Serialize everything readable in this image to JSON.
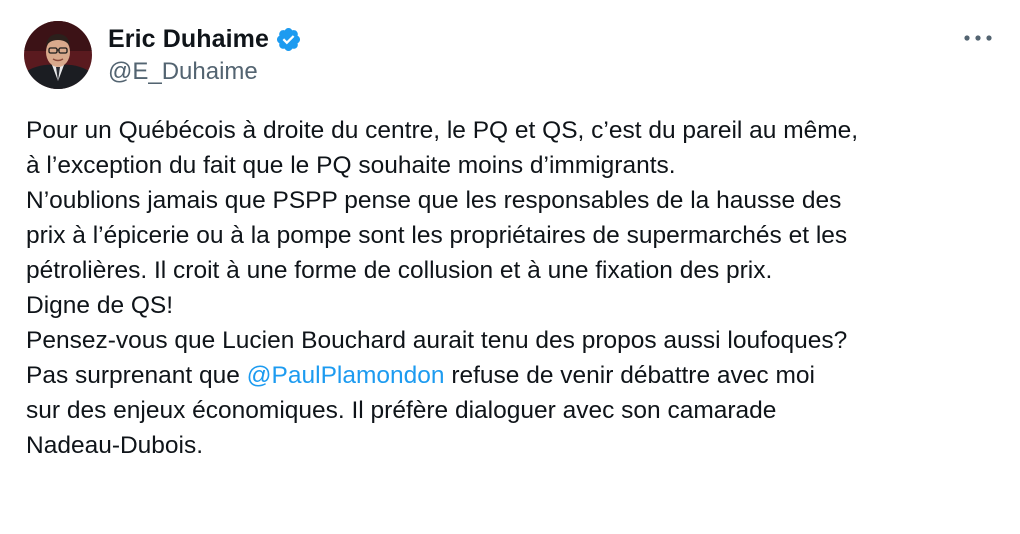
{
  "author": {
    "display_name": "Eric Duhaime",
    "handle": "@E_Duhaime",
    "verified": true,
    "verified_color": "#1d9bf0",
    "avatar_icon": "avatar-photo"
  },
  "menu": {
    "icon": "more-icon"
  },
  "tweet": {
    "lines": [
      "Pour un Québécois à droite du centre, le PQ et QS, c’est du pareil au même,",
      "à l’exception du fait que le PQ souhaite moins d’immigrants.",
      "N’oublions jamais que PSPP pense que les responsables de la hausse des",
      "prix à l’épicerie ou à la pompe sont les propriétaires de supermarchés et les",
      "pétrolières. Il croit à une forme de collusion et à une fixation des prix.",
      "Digne de QS!",
      "Pensez-vous que Lucien Bouchard aurait tenu des propos aussi loufoques?"
    ],
    "mention_line": {
      "prefix": "Pas surprenant que ",
      "mention": "@PaulPlamondon",
      "suffix": " refuse de venir débattre avec moi"
    },
    "tail_lines": [
      "sur des enjeux économiques. Il préfère dialoguer avec son camarade",
      "Nadeau-Dubois."
    ],
    "mention_color": "#1d9bf0"
  }
}
